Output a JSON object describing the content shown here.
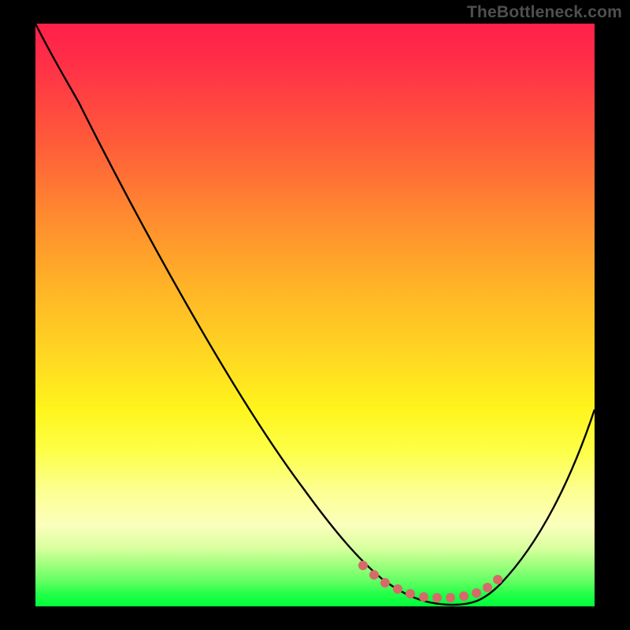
{
  "watermark": "TheBottleneck.com",
  "chart_data": {
    "type": "line",
    "title": "",
    "xlabel": "",
    "ylabel": "",
    "xlim": [
      0,
      100
    ],
    "ylim": [
      0,
      100
    ],
    "grid": false,
    "legend": false,
    "series": [
      {
        "name": "main-curve",
        "color": "#000000",
        "x": [
          0,
          5,
          10,
          20,
          30,
          40,
          50,
          57,
          62,
          66,
          70,
          74,
          78,
          80,
          84,
          90,
          95,
          100
        ],
        "y": [
          100,
          93,
          87,
          73,
          59,
          45,
          31,
          21,
          13,
          7,
          3,
          1,
          0.5,
          0.8,
          3,
          12,
          22,
          34
        ]
      },
      {
        "name": "bottom-marker-band",
        "color": "#d66a6a",
        "x": [
          57,
          62,
          66,
          70,
          74,
          78,
          80
        ],
        "y": [
          3.3,
          2.6,
          1.9,
          1.5,
          1.4,
          1.8,
          2.4
        ]
      }
    ],
    "annotations": []
  },
  "colors": {
    "frame_bg": "#000000",
    "curve": "#000000",
    "marker_band": "#d66a6a",
    "watermark": "#4f4f4f"
  }
}
